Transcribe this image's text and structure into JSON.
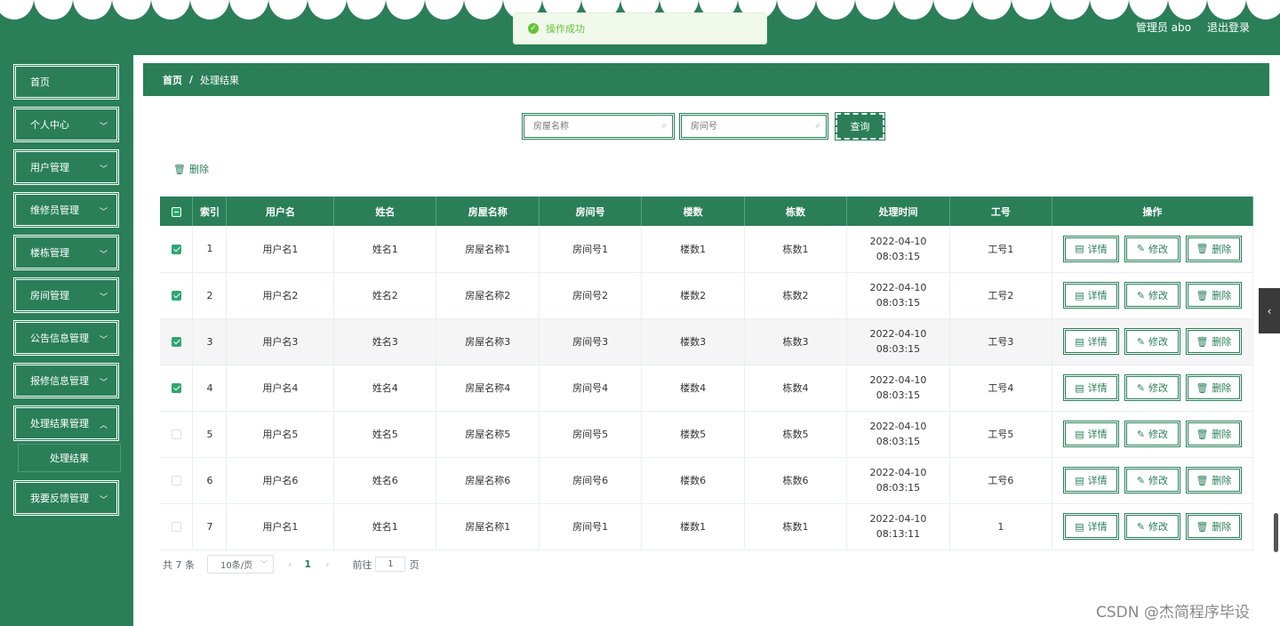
{
  "header": {
    "role": "管理员 abo",
    "logout": "退出登录"
  },
  "toast": {
    "message": "操作成功"
  },
  "sidebar": {
    "items": [
      {
        "label": "首页"
      },
      {
        "label": "个人中心"
      },
      {
        "label": "用户管理"
      },
      {
        "label": "维修员管理"
      },
      {
        "label": "楼栋管理"
      },
      {
        "label": "房间管理"
      },
      {
        "label": "公告信息管理"
      },
      {
        "label": "报修信息管理"
      },
      {
        "label": "处理结果管理"
      },
      {
        "label": "我要反馈管理"
      }
    ],
    "submenu": "处理结果"
  },
  "breadcrumb": {
    "home": "首页",
    "sep": "/",
    "current": "处理结果"
  },
  "search": {
    "room_name_placeholder": "房屋名称",
    "room_no_placeholder": "房间号",
    "query": "查询"
  },
  "toolbar": {
    "delete": "删除"
  },
  "table": {
    "headers": [
      "索引",
      "用户名",
      "姓名",
      "房屋名称",
      "房间号",
      "楼数",
      "栋数",
      "处理时间",
      "工号",
      "操作"
    ],
    "rows": [
      {
        "checked": true,
        "idx": "1",
        "user": "用户名1",
        "name": "姓名1",
        "house": "房屋名称1",
        "room": "房间号1",
        "floor": "楼数1",
        "building": "栋数1",
        "time": "2022-04-10 08:03:15",
        "no": "工号1"
      },
      {
        "checked": true,
        "idx": "2",
        "user": "用户名2",
        "name": "姓名2",
        "house": "房屋名称2",
        "room": "房间号2",
        "floor": "楼数2",
        "building": "栋数2",
        "time": "2022-04-10 08:03:15",
        "no": "工号2"
      },
      {
        "checked": true,
        "idx": "3",
        "user": "用户名3",
        "name": "姓名3",
        "house": "房屋名称3",
        "room": "房间号3",
        "floor": "楼数3",
        "building": "栋数3",
        "time": "2022-04-10 08:03:15",
        "no": "工号3"
      },
      {
        "checked": true,
        "idx": "4",
        "user": "用户名4",
        "name": "姓名4",
        "house": "房屋名称4",
        "room": "房间号4",
        "floor": "楼数4",
        "building": "栋数4",
        "time": "2022-04-10 08:03:15",
        "no": "工号4"
      },
      {
        "checked": false,
        "idx": "5",
        "user": "用户名5",
        "name": "姓名5",
        "house": "房屋名称5",
        "room": "房间号5",
        "floor": "楼数5",
        "building": "栋数5",
        "time": "2022-04-10 08:03:15",
        "no": "工号5"
      },
      {
        "checked": false,
        "idx": "6",
        "user": "用户名6",
        "name": "姓名6",
        "house": "房屋名称6",
        "room": "房间号6",
        "floor": "楼数6",
        "building": "栋数6",
        "time": "2022-04-10 08:03:15",
        "no": "工号6"
      },
      {
        "checked": false,
        "idx": "7",
        "user": "用户名1",
        "name": "姓名1",
        "house": "房屋名称1",
        "room": "房间号1",
        "floor": "楼数1",
        "building": "栋数1",
        "time": "2022-04-10 08:13:11",
        "no": "1"
      }
    ],
    "actions": {
      "detail": "详情",
      "edit": "修改",
      "delete": "删除"
    }
  },
  "pagination": {
    "total": "共 7 条",
    "page_size": "10条/页",
    "current": "1",
    "goto_prefix": "前往",
    "goto_value": "1",
    "goto_suffix": "页"
  },
  "watermark": "CSDN @杰简程序毕设",
  "colors": {
    "primary": "#2a7f59",
    "success": "#67c23a"
  }
}
